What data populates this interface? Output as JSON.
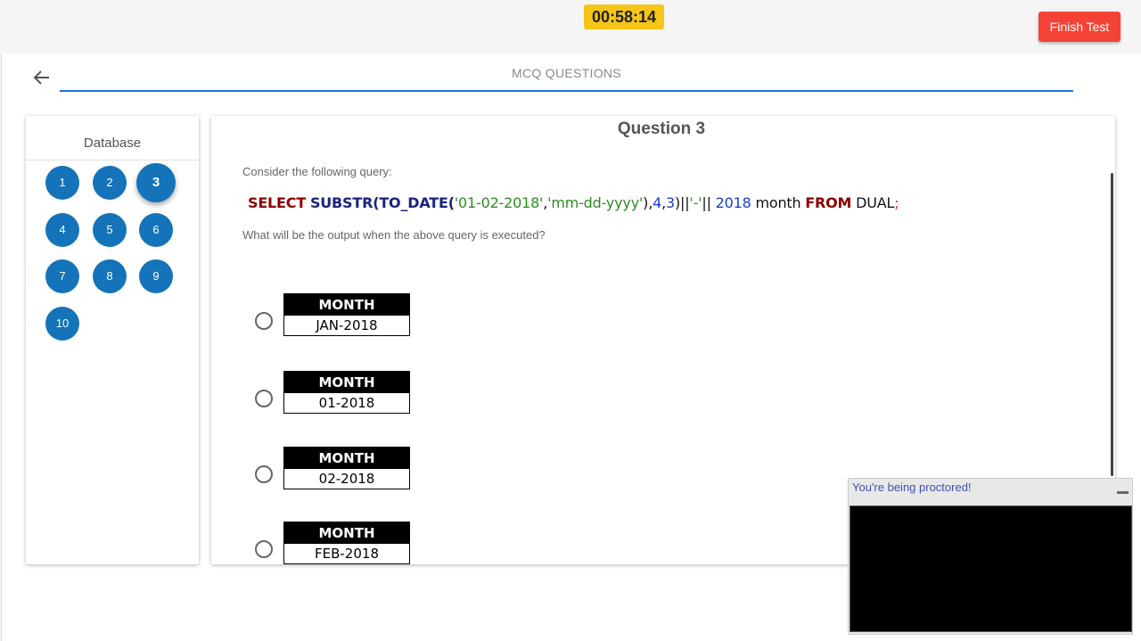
{
  "topbar": {
    "timer": "00:58:14",
    "finish_label": "Finish Test"
  },
  "header": {
    "section_title": "MCQ QUESTIONS"
  },
  "sidebar": {
    "title": "Database",
    "questions": [
      "1",
      "2",
      "3",
      "4",
      "5",
      "6",
      "7",
      "8",
      "9",
      "10"
    ],
    "active": "3"
  },
  "question": {
    "title": "Question 3",
    "intro": "Consider the following query:",
    "sql": {
      "t1": "SELECT",
      "t2": "SUBSTR",
      "t3": "(",
      "t4": "TO_DATE",
      "t5": "(",
      "t6": "'01-02-2018'",
      "t7": ",",
      "t8": "'mm-dd-yyyy'",
      "t9": "),",
      "t10": "4",
      "t11": ",",
      "t12": "3",
      "t13": ")||",
      "t14": "'-'",
      "t15": "|| ",
      "t16": "2018",
      "t17": " month ",
      "t18": "FROM",
      "t19": " DUAL",
      "t20": ";"
    },
    "prompt": "What will be the output when the above query is executed?",
    "options": [
      {
        "header": "MONTH",
        "value": "JAN-2018"
      },
      {
        "header": "MONTH",
        "value": "01-2018"
      },
      {
        "header": "MONTH",
        "value": "02-2018"
      },
      {
        "header": "MONTH",
        "value": "FEB-2018"
      }
    ]
  },
  "proctor": {
    "label": "You're being proctored!"
  },
  "colors": {
    "timer_bg": "#f5c518",
    "finish_bg": "#f44336",
    "accent": "#1473b9",
    "underline": "#1976d2"
  }
}
